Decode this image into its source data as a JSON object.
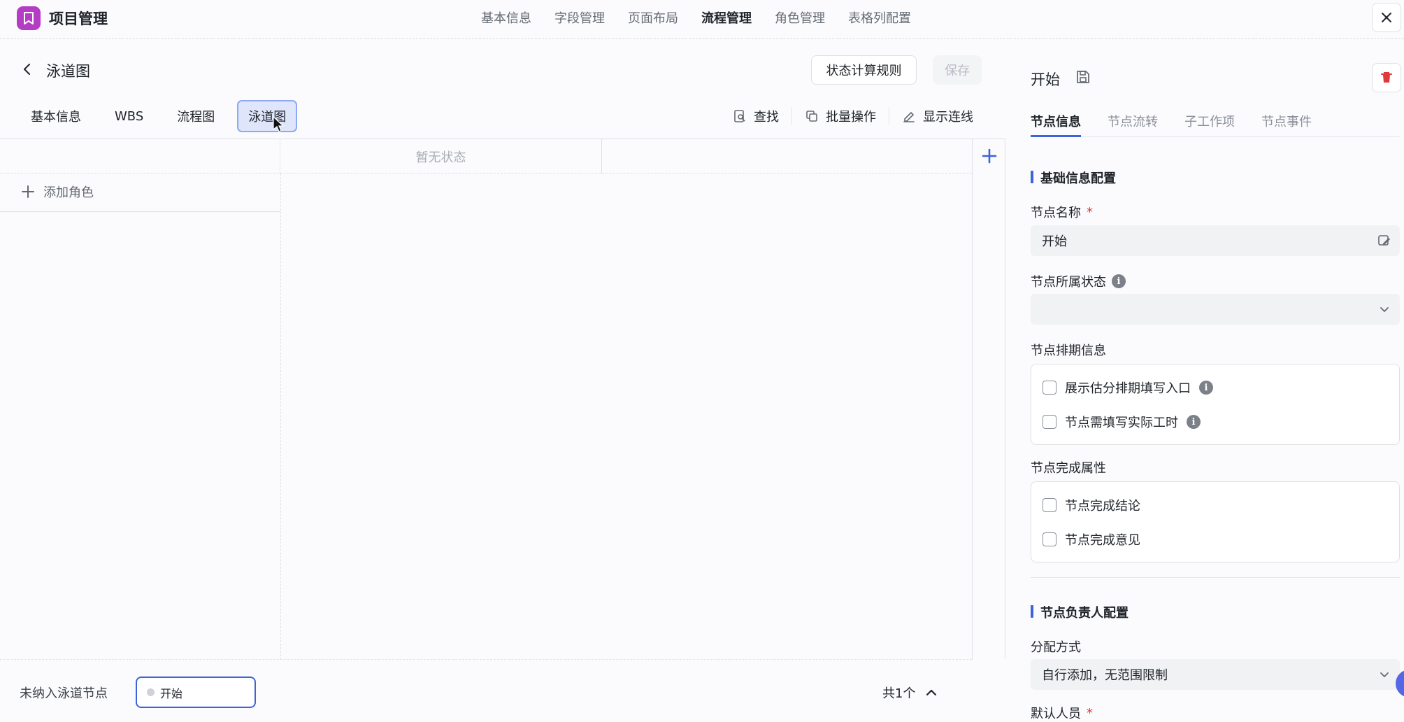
{
  "app": {
    "title": "项目管理"
  },
  "topnav": [
    {
      "label": "基本信息",
      "active": false
    },
    {
      "label": "字段管理",
      "active": false
    },
    {
      "label": "页面布局",
      "active": false
    },
    {
      "label": "流程管理",
      "active": true
    },
    {
      "label": "角色管理",
      "active": false
    },
    {
      "label": "表格列配置",
      "active": false
    }
  ],
  "page": {
    "title": "泳道图",
    "rule_button": "状态计算规则",
    "save_button": "保存"
  },
  "subtabs": [
    {
      "label": "基本信息",
      "active": false
    },
    {
      "label": "WBS",
      "active": false
    },
    {
      "label": "流程图",
      "active": false
    },
    {
      "label": "泳道图",
      "active": true
    }
  ],
  "tools": {
    "find": "查找",
    "batch": "批量操作",
    "show_lines": "显示连线"
  },
  "board": {
    "empty_status": "暂无状态",
    "add_role": "添加角色",
    "footer_label": "未纳入泳道节点",
    "footer_node": "开始",
    "footer_count": "共1个"
  },
  "panel": {
    "node_title": "开始",
    "tabs": [
      {
        "label": "节点信息",
        "active": true
      },
      {
        "label": "节点流转",
        "active": false
      },
      {
        "label": "子工作项",
        "active": false
      },
      {
        "label": "节点事件",
        "active": false
      }
    ],
    "section_basic": "基础信息配置",
    "node_name_label": "节点名称",
    "required_mark": "*",
    "node_name_value": "开始",
    "node_status_label": "节点所属状态",
    "node_status_value": "",
    "schedule_label": "节点排期信息",
    "schedule_options": [
      "展示估分排期填写入口",
      "节点需填写实际工时"
    ],
    "complete_label": "节点完成属性",
    "complete_options": [
      "节点完成结论",
      "节点完成意见"
    ],
    "section_owner": "节点负责人配置",
    "assign_label": "分配方式",
    "assign_value": "自行添加，无范围限制",
    "default_person_label": "默认人员",
    "info_glyph": "i"
  },
  "colors": {
    "accent": "#3c63d8",
    "brand": "#b53cc4",
    "danger": "#e03a3a"
  }
}
